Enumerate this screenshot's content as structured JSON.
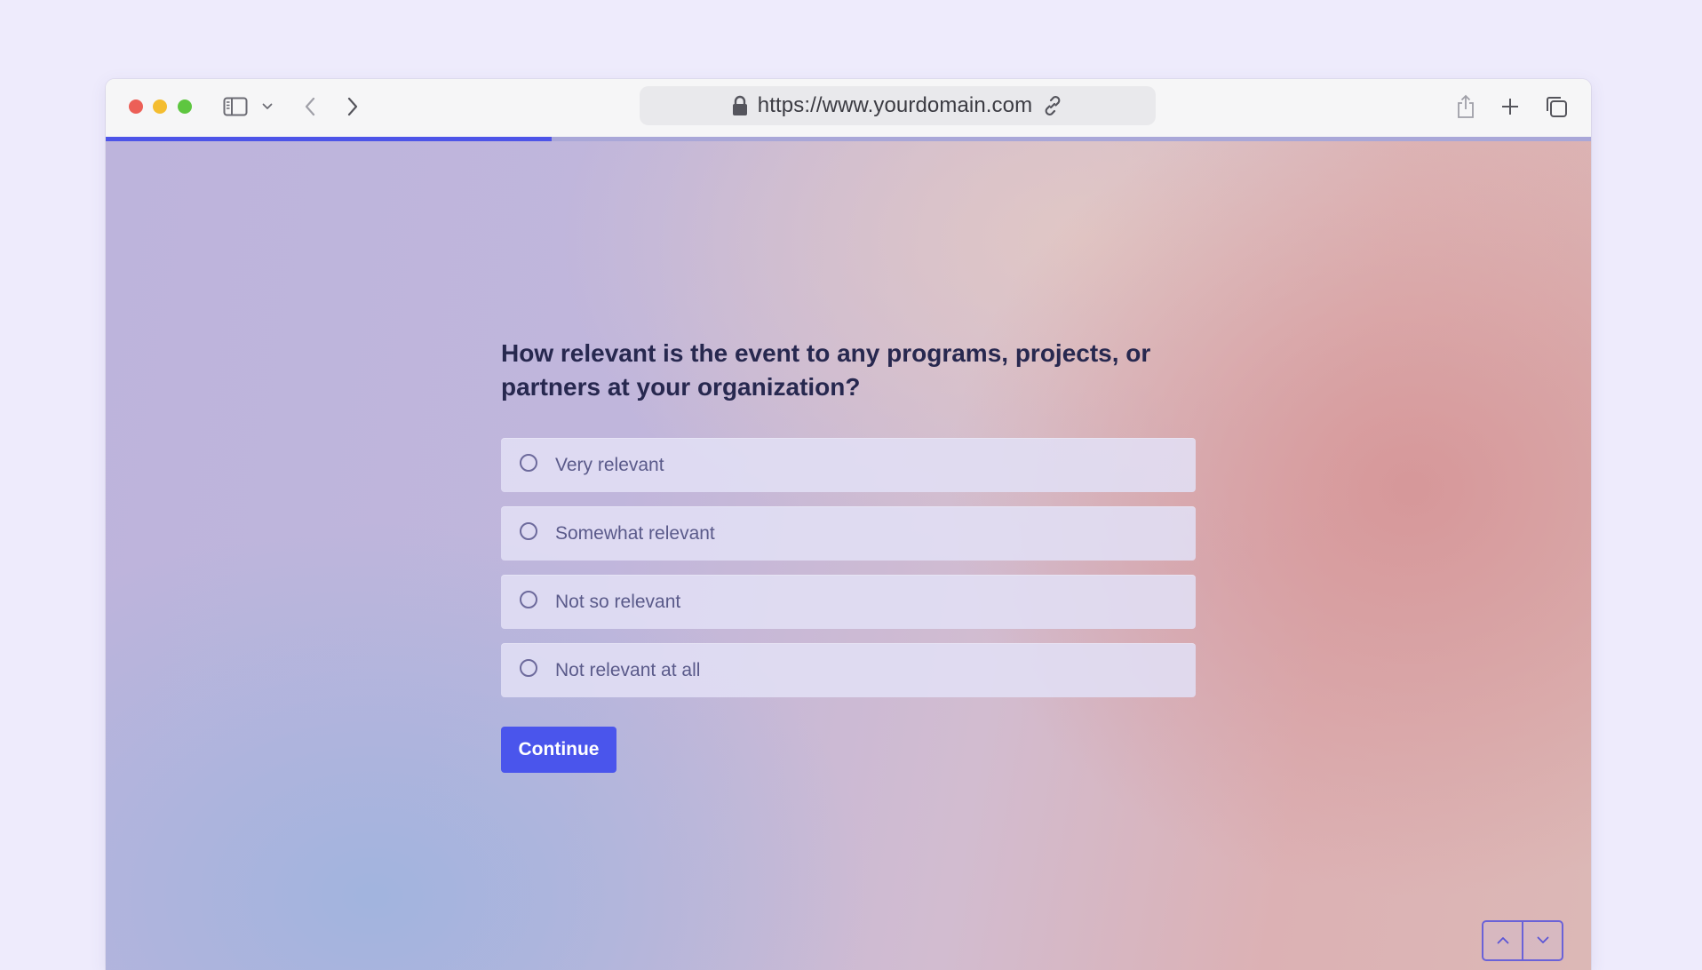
{
  "browser": {
    "url": "https://www.yourdomain.com",
    "progress_fraction": 0.3
  },
  "survey": {
    "question": "How relevant is the event to any programs, projects, or partners at your organization?",
    "options": [
      {
        "label": "Very relevant"
      },
      {
        "label": "Somewhat relevant"
      },
      {
        "label": "Not so relevant"
      },
      {
        "label": "Not relevant at all"
      }
    ],
    "continue_label": "Continue"
  },
  "icons": {
    "lock": "lock-icon",
    "link": "link-icon",
    "sidebar": "sidebar-icon",
    "back": "chevron-left-icon",
    "forward": "chevron-right-icon",
    "share": "share-icon",
    "new_tab": "plus-icon",
    "tabs": "tabs-overview-icon",
    "nav_up": "chevron-up-icon",
    "nav_down": "chevron-down-icon"
  },
  "colors": {
    "accent": "#4a55ec",
    "progress": "#4d54e8",
    "question_text": "#27284f",
    "option_bg": "#e1dff5"
  }
}
